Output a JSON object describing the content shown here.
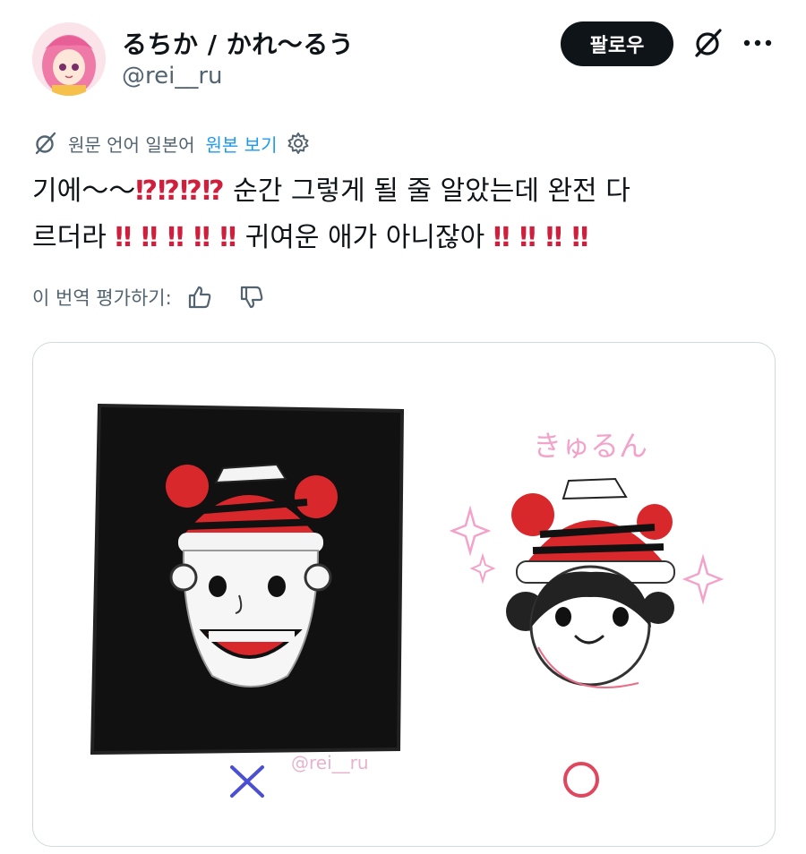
{
  "author": {
    "display_name": "るちか / かれ〜るう",
    "handle": "@rei__ru"
  },
  "actions": {
    "follow_label": "팔로우"
  },
  "translation": {
    "info": "원문 언어 일본어",
    "show_original": "원본 보기"
  },
  "tweet": {
    "line1_a": "기에〜〜",
    "line1_em": "⁉⁉⁉⁉",
    "line1_b": " 순간 그렇게 될 줄 알았는데 완전 다",
    "line2_a": "르더라 ",
    "line2_em": "‼ ‼ ‼ ‼ ‼",
    "line2_b": " 귀여운 애가 아니잖아 ",
    "line2_em2": "‼ ‼ ‼ ‼"
  },
  "rating": {
    "label": "이 번역 평가하기:"
  },
  "media": {
    "handwritten_caption": "きゅるん",
    "watermark": "@rei__ru",
    "mark_left": "×",
    "mark_right": "○"
  },
  "colors": {
    "follow_bg": "#0f1419",
    "link": "#1d9bf0",
    "secondary_text": "#536471",
    "emphasis": "#d01f3c",
    "border": "#cfd9de"
  },
  "icons": [
    "grok-icon",
    "more-icon",
    "grok-small-icon",
    "gear-icon",
    "thumbs-up-icon",
    "thumbs-down-icon"
  ]
}
